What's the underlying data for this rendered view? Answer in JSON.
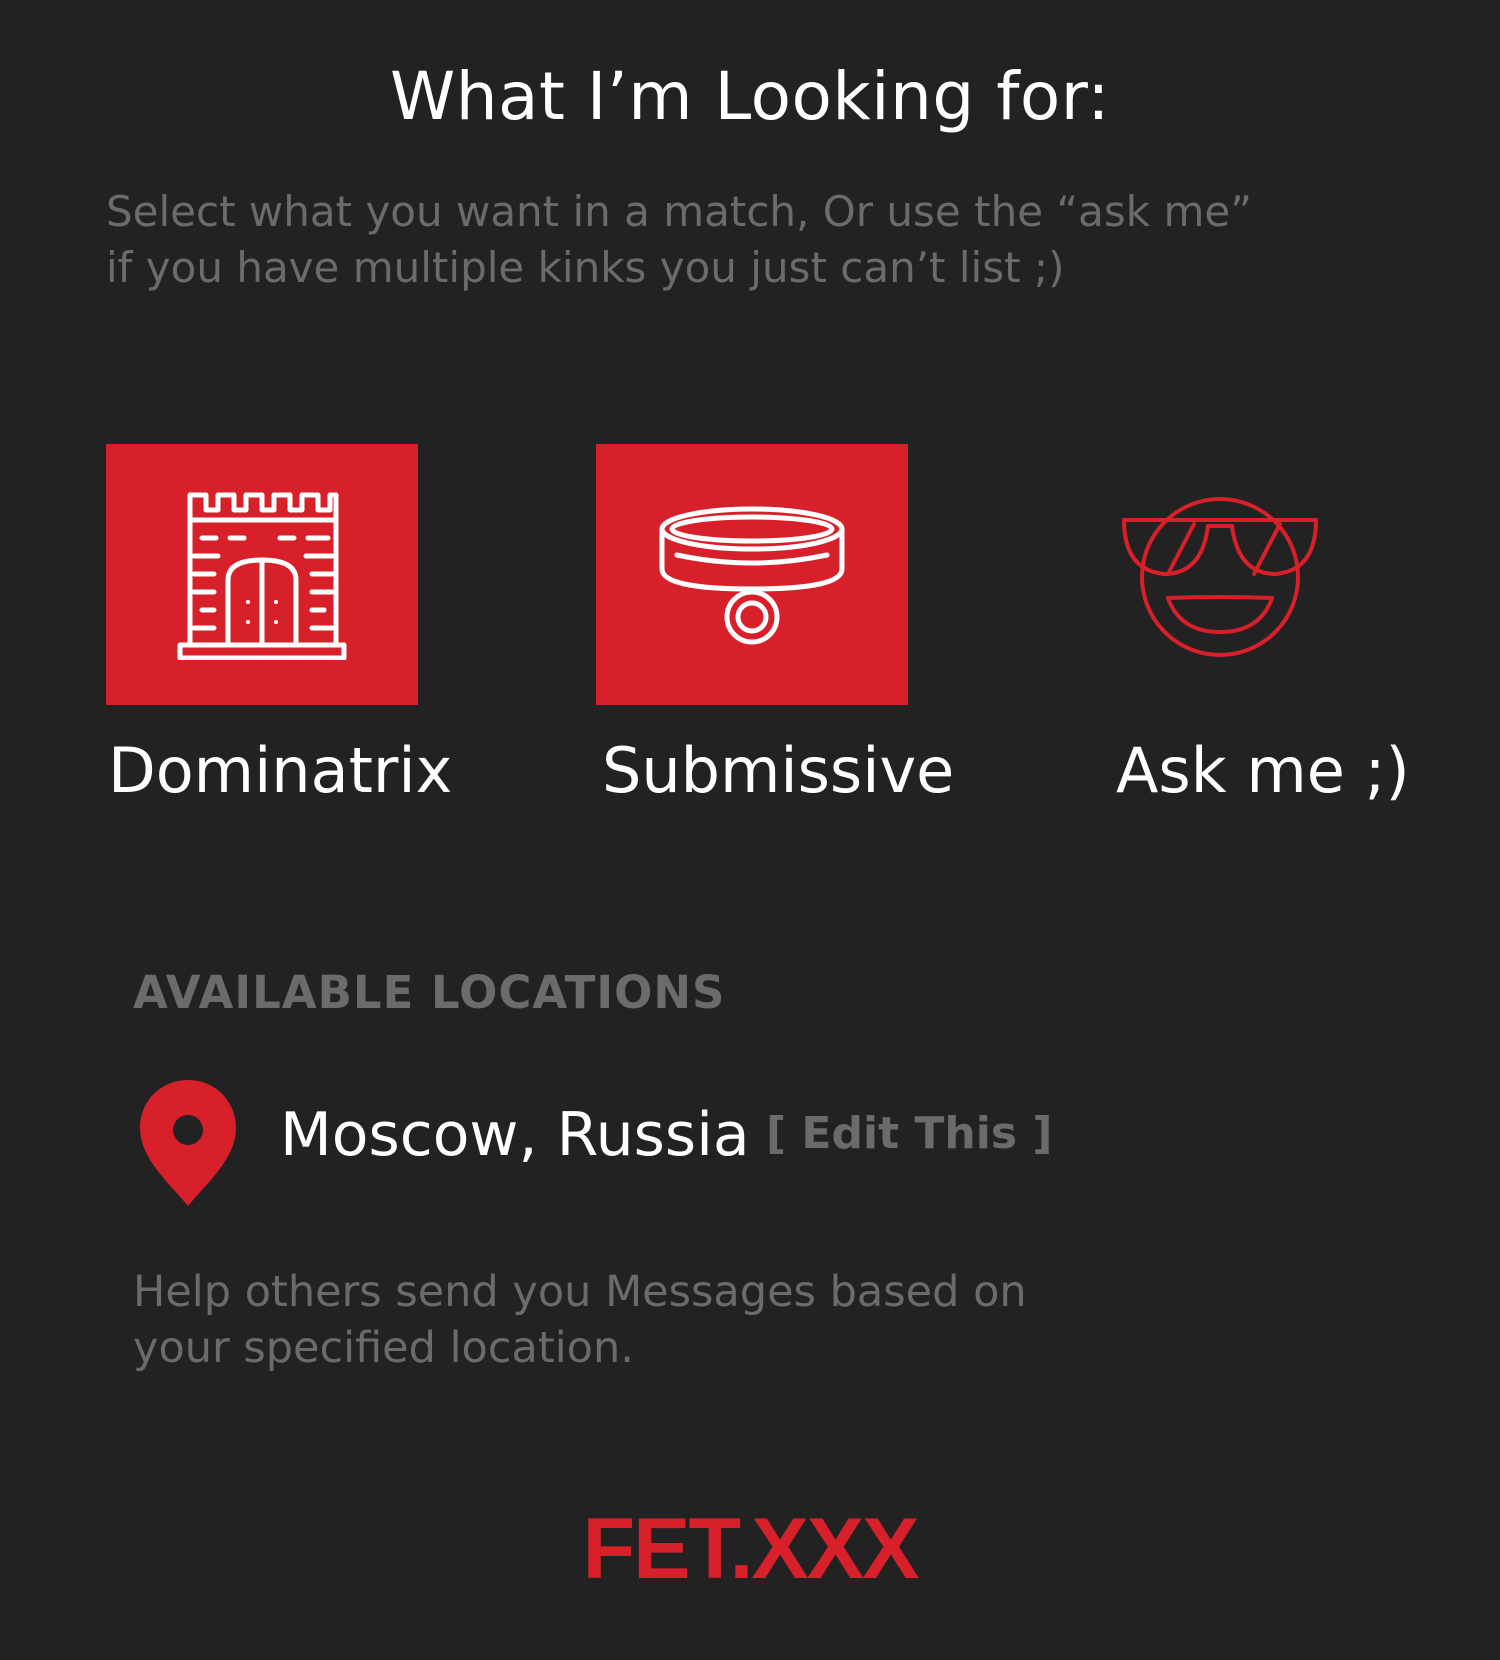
{
  "header": {
    "title": "What I’m Looking for:",
    "subtitle_line1": "Select what you want in a match, Or use the “ask me”",
    "subtitle_line2": "if you have multiple kinks you just can’t list ;)"
  },
  "options": [
    {
      "label": "Dominatrix",
      "icon": "castle-icon",
      "selected": true
    },
    {
      "label": "Submissive",
      "icon": "collar-icon",
      "selected": true
    },
    {
      "label": "Ask me ;)",
      "icon": "sunglasses-smiley-icon",
      "selected": false
    }
  ],
  "locations": {
    "section_title": "AVAILABLE LOCATIONS",
    "location_icon": "map-pin-icon",
    "current": "Moscow, Russia",
    "edit_label": "[ Edit This ]",
    "help_line1": "Help others send you Messages based on",
    "help_line2": "your specified location."
  },
  "brand": {
    "logo_text": "FET.XXX"
  },
  "colors": {
    "background": "#222222",
    "accent": "#d8202a",
    "muted_text": "#6b6b6b",
    "text": "#ffffff"
  }
}
